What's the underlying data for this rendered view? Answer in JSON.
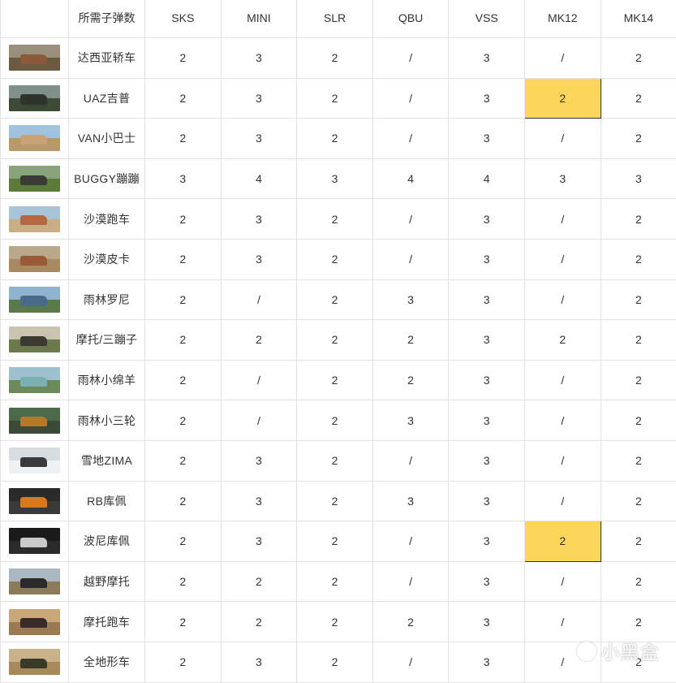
{
  "header": {
    "corner": "",
    "name_col": "所需子弹数",
    "weapons": [
      "SKS",
      "MINI",
      "SLR",
      "QBU",
      "VSS",
      "MK12",
      "MK14"
    ]
  },
  "rows": [
    {
      "vehicle": "达西亚轿车",
      "values": [
        "2",
        "3",
        "2",
        "/",
        "3",
        "/",
        "2"
      ],
      "thumb": [
        "#9a8f7a",
        "#6b5a3e",
        "#8a5a3a"
      ]
    },
    {
      "vehicle": "UAZ吉普",
      "values": [
        "2",
        "3",
        "2",
        "/",
        "3",
        "2",
        "2"
      ],
      "thumb": [
        "#7f8f8a",
        "#3c4a36",
        "#2e332c"
      ],
      "highlight": 5
    },
    {
      "vehicle": "VAN小巴士",
      "values": [
        "2",
        "3",
        "2",
        "/",
        "3",
        "/",
        "2"
      ],
      "thumb": [
        "#9fc3df",
        "#b89a6a",
        "#c9a27a"
      ]
    },
    {
      "vehicle": "BUGGY蹦蹦",
      "values": [
        "3",
        "4",
        "3",
        "4",
        "4",
        "3",
        "3"
      ],
      "thumb": [
        "#8aa27a",
        "#5e7a3a",
        "#3a3a36"
      ]
    },
    {
      "vehicle": "沙漠跑车",
      "values": [
        "2",
        "3",
        "2",
        "/",
        "3",
        "/",
        "2"
      ],
      "thumb": [
        "#a9c3d8",
        "#c9ad84",
        "#b26a44"
      ]
    },
    {
      "vehicle": "沙漠皮卡",
      "values": [
        "2",
        "3",
        "2",
        "/",
        "3",
        "/",
        "2"
      ],
      "thumb": [
        "#b9a88a",
        "#a88a62",
        "#9a5a38"
      ]
    },
    {
      "vehicle": "雨林罗尼",
      "values": [
        "2",
        "/",
        "2",
        "3",
        "3",
        "/",
        "2"
      ],
      "thumb": [
        "#8fb2cf",
        "#5a7a4a",
        "#4a6a8a"
      ]
    },
    {
      "vehicle": "摩托/三蹦子",
      "values": [
        "2",
        "2",
        "2",
        "2",
        "3",
        "2",
        "2"
      ],
      "thumb": [
        "#c9c3b0",
        "#6a7a4a",
        "#3a3a30"
      ]
    },
    {
      "vehicle": "雨林小绵羊",
      "values": [
        "2",
        "/",
        "2",
        "2",
        "3",
        "/",
        "2"
      ],
      "thumb": [
        "#9fc0cf",
        "#6a8a5a",
        "#7ab0b0"
      ]
    },
    {
      "vehicle": "雨林小三轮",
      "values": [
        "2",
        "/",
        "2",
        "3",
        "3",
        "/",
        "2"
      ],
      "thumb": [
        "#4a6a4a",
        "#3a4a36",
        "#b8782a"
      ]
    },
    {
      "vehicle": "雪地ZIMA",
      "values": [
        "2",
        "3",
        "2",
        "/",
        "3",
        "/",
        "2"
      ],
      "thumb": [
        "#d8dde2",
        "#eef0f2",
        "#3a3a3a"
      ]
    },
    {
      "vehicle": "RB库佩",
      "values": [
        "2",
        "3",
        "2",
        "3",
        "3",
        "/",
        "2"
      ],
      "thumb": [
        "#2a2a2a",
        "#3a3a3a",
        "#d8781a"
      ]
    },
    {
      "vehicle": "波尼库佩",
      "values": [
        "2",
        "3",
        "2",
        "/",
        "3",
        "2",
        "2"
      ],
      "thumb": [
        "#1a1a1a",
        "#2a2a2a",
        "#c9c9c9"
      ],
      "highlight": 5
    },
    {
      "vehicle": "越野摩托",
      "values": [
        "2",
        "2",
        "2",
        "/",
        "3",
        "/",
        "2"
      ],
      "thumb": [
        "#a9b8c0",
        "#8a7a5a",
        "#2a2a2a"
      ]
    },
    {
      "vehicle": "摩托跑车",
      "values": [
        "2",
        "2",
        "2",
        "2",
        "3",
        "/",
        "2"
      ],
      "thumb": [
        "#c8a878",
        "#9a7a52",
        "#3a2a2a"
      ]
    },
    {
      "vehicle": "全地形车",
      "values": [
        "2",
        "3",
        "2",
        "/",
        "3",
        "/",
        "2"
      ],
      "thumb": [
        "#c9b28a",
        "#a88a5a",
        "#3a3a2a"
      ]
    }
  ],
  "watermark": "小黑盒"
}
